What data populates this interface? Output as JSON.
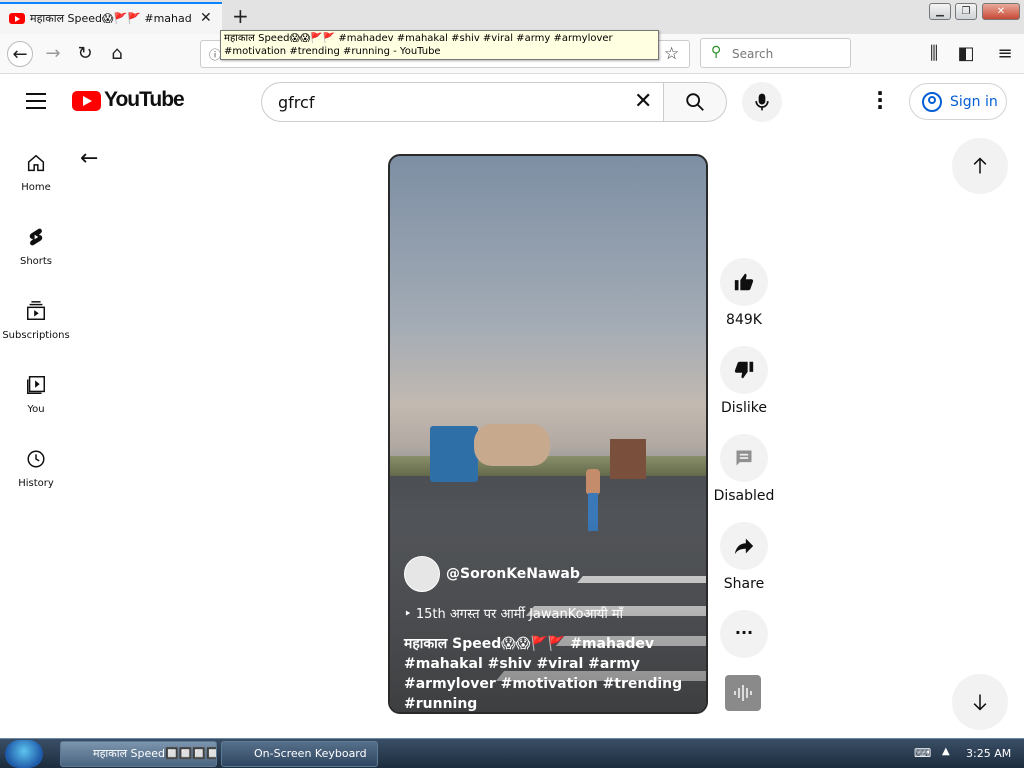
{
  "browser": {
    "tab_title": "महाकाल Speed😱🚩🚩 #mahad",
    "tooltip_line1": "महाकाल Speed😱😱🚩🚩 #mahadev #mahakal #shiv #viral #army #armylover",
    "tooltip_line2": "#motivation #trending #running - YouTube",
    "search_placeholder": "Search"
  },
  "youtube": {
    "logo_text": "YouTube",
    "search_value": "gfrcf",
    "signin_label": "Sign in",
    "sidebar": [
      {
        "label": "Home",
        "icon": "home-icon"
      },
      {
        "label": "Shorts",
        "icon": "shorts-icon"
      },
      {
        "label": "Subscriptions",
        "icon": "subscriptions-icon"
      },
      {
        "label": "You",
        "icon": "you-icon"
      },
      {
        "label": "History",
        "icon": "history-icon"
      }
    ],
    "short": {
      "channel": "@SoronKeNawab",
      "playlist": "15th अगस्त पर आर्मी JawanKoआयी माँ",
      "caption": "महाकाल Speed😱😱🚩🚩 #mahadev #mahakal #shiv #viral #army #armylover #motivation #trending #running"
    },
    "actions": {
      "like_count": "849K",
      "dislike_label": "Dislike",
      "comments_label": "Disabled",
      "share_label": "Share"
    }
  },
  "taskbar": {
    "item1": "महाकाल  Speed🔲🔲🔲🔲...",
    "item2": "On-Screen Keyboard",
    "clock": "3:25 AM"
  },
  "colors": {
    "youtube_red": "#ff0000",
    "link_blue": "#065fd4",
    "firefox_tab_accent": "#0a84ff"
  }
}
